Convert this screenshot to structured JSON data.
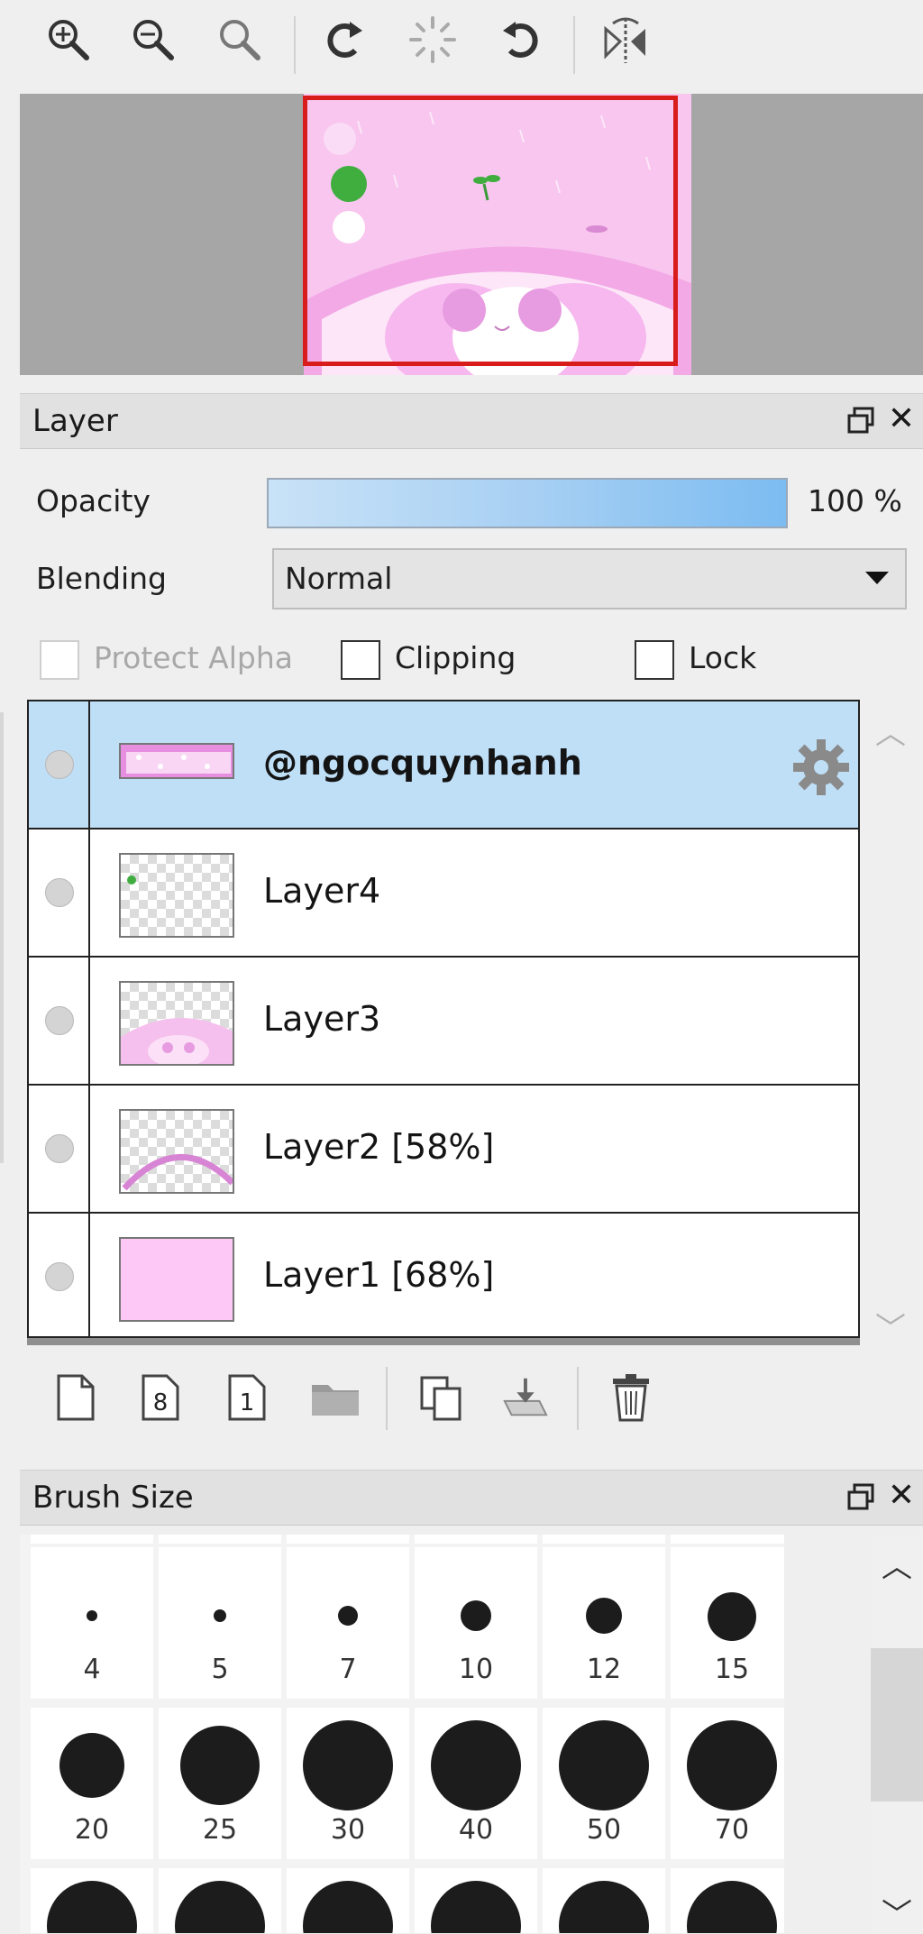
{
  "toolbar": {
    "buttons": [
      {
        "name": "zoom-in-icon"
      },
      {
        "name": "zoom-out-icon"
      },
      {
        "name": "zoom-reset-icon"
      },
      {
        "name": "rotate-left-icon"
      },
      {
        "name": "rotate-reset-icon"
      },
      {
        "name": "rotate-right-icon"
      },
      {
        "name": "flip-horizontal-icon"
      }
    ]
  },
  "layer_panel": {
    "title": "Layer",
    "opacity_label": "Opacity",
    "opacity_value": "100 %",
    "opacity_fraction": 1.0,
    "blending_label": "Blending",
    "blending_value": "Normal",
    "protect_alpha_label": "Protect Alpha",
    "clipping_label": "Clipping",
    "lock_label": "Lock",
    "layers": [
      {
        "name": "@ngocquynhanh",
        "selected": true
      },
      {
        "name": "Layer4",
        "selected": false
      },
      {
        "name": "Layer3",
        "selected": false
      },
      {
        "name": "Layer2 [58%]",
        "selected": false
      },
      {
        "name": "Layer1 [68%]",
        "selected": false
      }
    ]
  },
  "brush_panel": {
    "title": "Brush Size",
    "sizes": [
      "4",
      "5",
      "7",
      "10",
      "12",
      "15",
      "20",
      "25",
      "30",
      "40",
      "50",
      "70"
    ]
  },
  "colors": {
    "selected_row": "#bfdff7",
    "canvas_pink": "#f8c6ef",
    "frame_red": "#d81c1c"
  }
}
